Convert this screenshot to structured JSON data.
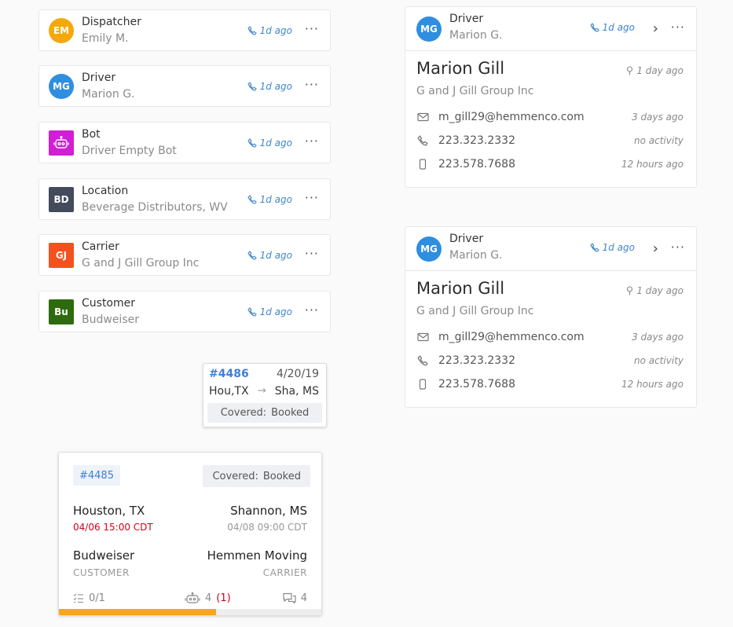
{
  "contacts": [
    {
      "role": "Dispatcher",
      "name": "Emily M.",
      "initials": "EM",
      "color": "#f5a80a",
      "shape": "circle",
      "ago": "1d ago"
    },
    {
      "role": "Driver",
      "name": "Marion G.",
      "initials": "MG",
      "color": "#2f8ee0",
      "shape": "circle",
      "ago": "1d ago"
    },
    {
      "role": "Bot",
      "name": "Driver Empty Bot",
      "initials": "",
      "color": "#d01ed6",
      "shape": "square",
      "ago": "1d ago",
      "icon": "robot-icon"
    },
    {
      "role": "Location",
      "name": "Beverage Distributors, WV",
      "initials": "BD",
      "color": "#434b5c",
      "shape": "square",
      "ago": "1d ago"
    },
    {
      "role": "Carrier",
      "name": "G and J Gill Group Inc",
      "initials": "GJ",
      "color": "#f4511e",
      "shape": "square",
      "ago": "1d ago"
    },
    {
      "role": "Customer",
      "name": "Budweiser",
      "initials": "Bu",
      "color": "#2e6b10",
      "shape": "square",
      "ago": "1d ago"
    }
  ],
  "driver_cards": [
    {
      "role": "Driver",
      "short_name": "Marion G.",
      "initials": "MG",
      "ago": "1d ago",
      "full_name": "Marion Gill",
      "company": "G and J Gill Group Inc",
      "last_seen": "1 day ago",
      "email": "m_gill29@hemmenco.com",
      "email_when": "3 days ago",
      "phone": "223.323.2332",
      "phone_when": "no activity",
      "mobile": "223.578.7688",
      "mobile_when": "12 hours ago"
    },
    {
      "role": "Driver",
      "short_name": "Marion G.",
      "initials": "MG",
      "ago": "1d ago",
      "full_name": "Marion Gill",
      "company": "G and J Gill Group Inc",
      "last_seen": "1 day ago",
      "email": "m_gill29@hemmenco.com",
      "email_when": "3 days ago",
      "phone": "223.323.2332",
      "phone_when": "no activity",
      "mobile": "223.578.7688",
      "mobile_when": "12 hours ago"
    }
  ],
  "mini_load": {
    "number": "#4486",
    "date": "4/20/19",
    "from": "Hou,TX",
    "to": "Sha, MS",
    "status_label": "Covered:",
    "status_value": "Booked"
  },
  "load_card": {
    "number": "#4485",
    "status_label": "Covered:",
    "status_value": "Booked",
    "origin": "Houston, TX",
    "origin_time": "04/06 15:00 CDT",
    "destination": "Shannon, MS",
    "destination_time": "04/08 09:00 CDT",
    "customer": "Budweiser",
    "customer_label": "CUSTOMER",
    "carrier": "Hemmen Moving",
    "carrier_label": "CARRIER",
    "tasks": "0/1",
    "bots": "4",
    "bot_alerts": "(1)",
    "messages": "4",
    "progress": 0.6
  }
}
